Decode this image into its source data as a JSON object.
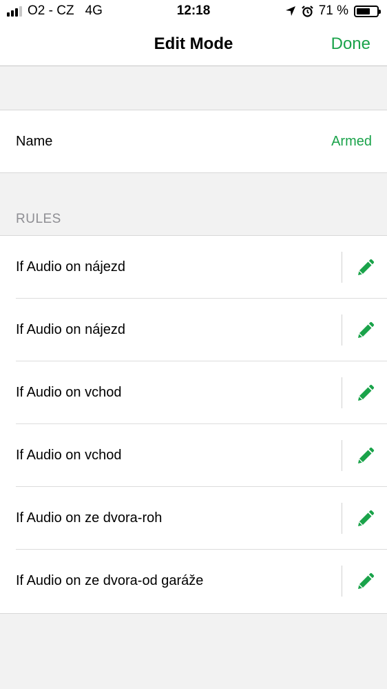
{
  "status_bar": {
    "carrier": "O2 - CZ",
    "network": "4G",
    "time": "12:18",
    "battery_percent": "71 %",
    "battery_level": 0.71
  },
  "nav": {
    "title": "Edit Mode",
    "done_label": "Done"
  },
  "name_row": {
    "label": "Name",
    "value": "Armed"
  },
  "rules_header": "RULES",
  "rules": [
    {
      "label": "If Audio on nájezd"
    },
    {
      "label": "If Audio on nájezd"
    },
    {
      "label": "If Audio on vchod"
    },
    {
      "label": "If Audio on vchod"
    },
    {
      "label": "If Audio on ze dvora-roh"
    },
    {
      "label": "If Audio on ze dvora-od garáže"
    }
  ],
  "colors": {
    "accent": "#1aa34a",
    "background": "#f2f2f2",
    "header_text": "#8e8e93"
  },
  "icons": {
    "rule_edit": "pencil-icon",
    "location": "location-arrow-icon",
    "alarm": "alarm-clock-icon",
    "signal": "signal-bars-icon",
    "battery": "battery-icon"
  }
}
